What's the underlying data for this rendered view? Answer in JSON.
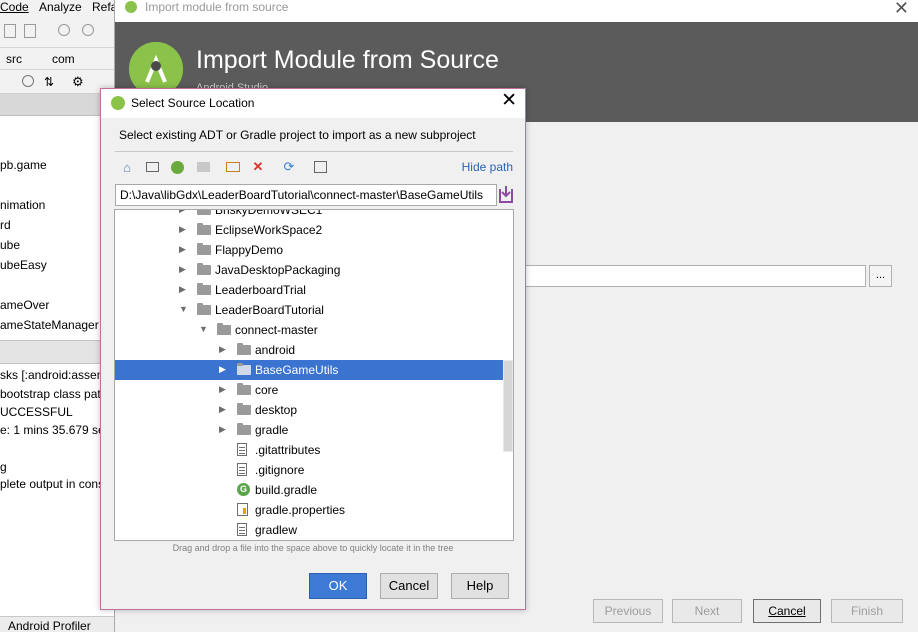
{
  "ide": {
    "menu": [
      "Code",
      "Analyze",
      "Refa"
    ],
    "breadcrumbs": [
      "src",
      "com"
    ],
    "tree_items": [
      "pb.game",
      "nimation",
      "rd",
      "ube",
      "ubeEasy",
      "ameOver",
      "ameStateManager"
    ],
    "build_lines": [
      "sks [:android:assem",
      " bootstrap class pat",
      "UCCESSFUL",
      "e: 1 mins 35.679 sec",
      "g",
      "plete output in cons"
    ],
    "status_bar": "Android Profiler"
  },
  "wizard": {
    "window_title": "Import module from source",
    "title": "Import Module from Source",
    "subtitle": "Android Studio",
    "browse_label": "...",
    "buttons": {
      "previous": "Previous",
      "next": "Next",
      "cancel": "Cancel",
      "finish": "Finish"
    }
  },
  "dialog": {
    "title": "Select Source Location",
    "description": "Select existing ADT or Gradle project to import as a new subproject",
    "hide_path": "Hide path",
    "path_value": "D:\\Java\\libGdx\\LeaderBoardTutorial\\connect-master\\BaseGameUtils",
    "hint": "Drag and drop a file into the space above to quickly locate it in the tree",
    "buttons": {
      "ok": "OK",
      "cancel": "Cancel",
      "help": "Help"
    },
    "tree": [
      {
        "label": "BriskyDemoWSEC1",
        "kind": "folder",
        "depth": 0,
        "arrow": "collapsed"
      },
      {
        "label": "EclipseWorkSpace2",
        "kind": "folder",
        "depth": 0,
        "arrow": "collapsed"
      },
      {
        "label": "FlappyDemo",
        "kind": "folder",
        "depth": 0,
        "arrow": "collapsed"
      },
      {
        "label": "JavaDesktopPackaging",
        "kind": "folder",
        "depth": 0,
        "arrow": "collapsed"
      },
      {
        "label": "LeaderboardTrial",
        "kind": "folder",
        "depth": 0,
        "arrow": "collapsed"
      },
      {
        "label": "LeaderBoardTutorial",
        "kind": "folder",
        "depth": 0,
        "arrow": "expanded"
      },
      {
        "label": "connect-master",
        "kind": "folder",
        "depth": 1,
        "arrow": "expanded"
      },
      {
        "label": "android",
        "kind": "folder",
        "depth": 2,
        "arrow": "collapsed"
      },
      {
        "label": "BaseGameUtils",
        "kind": "folder",
        "depth": 2,
        "arrow": "collapsed",
        "selected": true
      },
      {
        "label": "core",
        "kind": "folder",
        "depth": 2,
        "arrow": "collapsed"
      },
      {
        "label": "desktop",
        "kind": "folder",
        "depth": 2,
        "arrow": "collapsed"
      },
      {
        "label": "gradle",
        "kind": "folder",
        "depth": 2,
        "arrow": "collapsed"
      },
      {
        "label": ".gitattributes",
        "kind": "file",
        "depth": 2,
        "arrow": "none"
      },
      {
        "label": ".gitignore",
        "kind": "file",
        "depth": 2,
        "arrow": "none"
      },
      {
        "label": "build.gradle",
        "kind": "gradle",
        "depth": 2,
        "arrow": "none"
      },
      {
        "label": "gradle.properties",
        "kind": "props",
        "depth": 2,
        "arrow": "none"
      },
      {
        "label": "gradlew",
        "kind": "file",
        "depth": 2,
        "arrow": "none"
      }
    ]
  },
  "colors": {
    "accent": "#3a74d0",
    "header": "#5b5b5b",
    "android_green": "#8bc34a",
    "dialog_border": "#c0709a"
  }
}
